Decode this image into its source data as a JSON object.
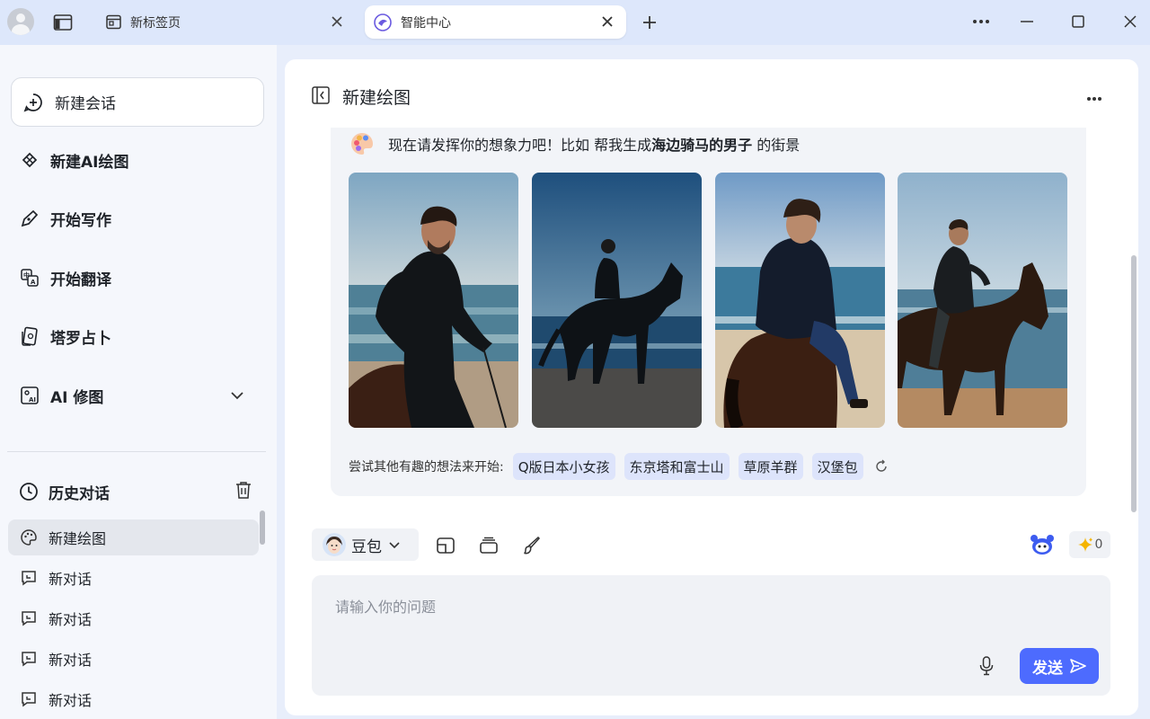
{
  "tabs": [
    {
      "label": "新标签页",
      "active": false,
      "icon": "newtab-icon"
    },
    {
      "label": "智能中心",
      "active": true,
      "icon": "ai-center-icon"
    }
  ],
  "sidebar": {
    "new_chat_label": "新建会话",
    "items": [
      {
        "label": "新建AI绘图",
        "icon": "ai-draw-icon"
      },
      {
        "label": "开始写作",
        "icon": "pen-icon"
      },
      {
        "label": "开始翻译",
        "icon": "translate-icon"
      },
      {
        "label": "塔罗占卜",
        "icon": "tarot-icon"
      },
      {
        "label": "AI 修图",
        "icon": "photo-edit-icon"
      }
    ],
    "history": {
      "title": "历史对话",
      "items": [
        {
          "label": "新建绘图",
          "active": true,
          "icon": "palette-icon"
        },
        {
          "label": "新对话",
          "active": false,
          "icon": "chat-icon"
        },
        {
          "label": "新对话",
          "active": false,
          "icon": "chat-icon"
        },
        {
          "label": "新对话",
          "active": false,
          "icon": "chat-icon"
        },
        {
          "label": "新对话",
          "active": false,
          "icon": "chat-icon"
        }
      ]
    }
  },
  "main": {
    "title": "新建绘图",
    "prompt": {
      "prefix": "现在请发挥你的想象力吧！比如 帮我生成",
      "highlight": "海边骑马的男子",
      "suffix": " 的街景"
    },
    "images": [
      {
        "alt": "man in black riding horse by the sea, close-up"
      },
      {
        "alt": "silhouette of rider on horse at blue hour beach"
      },
      {
        "alt": "curly-haired man on brown horse from behind"
      },
      {
        "alt": "man riding dark horse on sunny beach"
      }
    ],
    "suggest_label": "尝试其他有趣的想法来开始:",
    "suggestions": [
      "Q版日本小女孩",
      "东京塔和富士山",
      "草原羊群",
      "汉堡包"
    ],
    "model_label": "豆包",
    "credit_count": "0",
    "input_placeholder": "请输入你的问题",
    "input_value": "",
    "send_label": "发送"
  },
  "colors": {
    "accent": "#4d6bfe",
    "chip_bg": "#dde4fb",
    "titlebar_bg": "#dde7fb"
  }
}
